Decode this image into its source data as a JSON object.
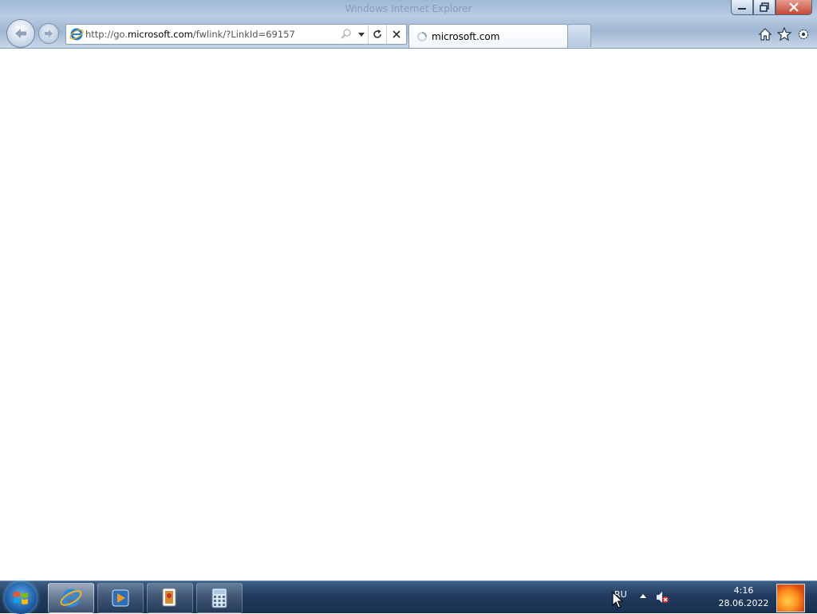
{
  "window": {
    "title": "Windows Internet Explorer"
  },
  "address_bar": {
    "url_prefix": "http://go.",
    "url_domain": "microsoft.com",
    "url_suffix": "/fwlink/?LinkId=69157"
  },
  "tabs": [
    {
      "label": "microsoft.com",
      "loading": true
    }
  ],
  "command_icons": [
    "home-icon",
    "favorites-star-icon",
    "tools-gear-icon"
  ],
  "taskbar": {
    "pinned": [
      "internet-explorer",
      "windows-media-player",
      "solitaire",
      "calculator"
    ],
    "active": "internet-explorer"
  },
  "tray": {
    "language": "RU",
    "time": "4:16",
    "date": "28.06.2022",
    "volume_muted": true
  },
  "colors": {
    "taskbar": "#213b5e",
    "chrome": "#b9cde4",
    "close_button": "#c54a36"
  }
}
